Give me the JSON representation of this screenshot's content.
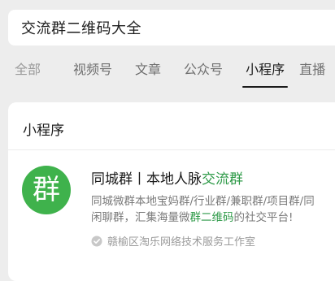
{
  "search": {
    "query": "交流群二维码大全"
  },
  "tabs": [
    {
      "label": "全部"
    },
    {
      "label": "视频号"
    },
    {
      "label": "文章"
    },
    {
      "label": "公众号"
    },
    {
      "label": "小程序",
      "active": true
    },
    {
      "label": "直播"
    }
  ],
  "section": {
    "title": "小程序",
    "result": {
      "icon_char": "群",
      "icon_color": "#3fb24c",
      "title_prefix": "同城群丨本地人脉",
      "title_highlight": "交流群",
      "highlight_color": "#2e9a48",
      "desc_line1": "同城微群本地宝妈群/行业群/兼职群/项目群/同",
      "desc_line2_prefix": "闲聊群，汇集海量微",
      "desc_line2_highlight": "群二维码",
      "desc_line2_suffix": "的社交平台!",
      "developer": "赣榆区淘乐网络技术服务工作室",
      "verified_icon": "verified-check-icon"
    }
  }
}
